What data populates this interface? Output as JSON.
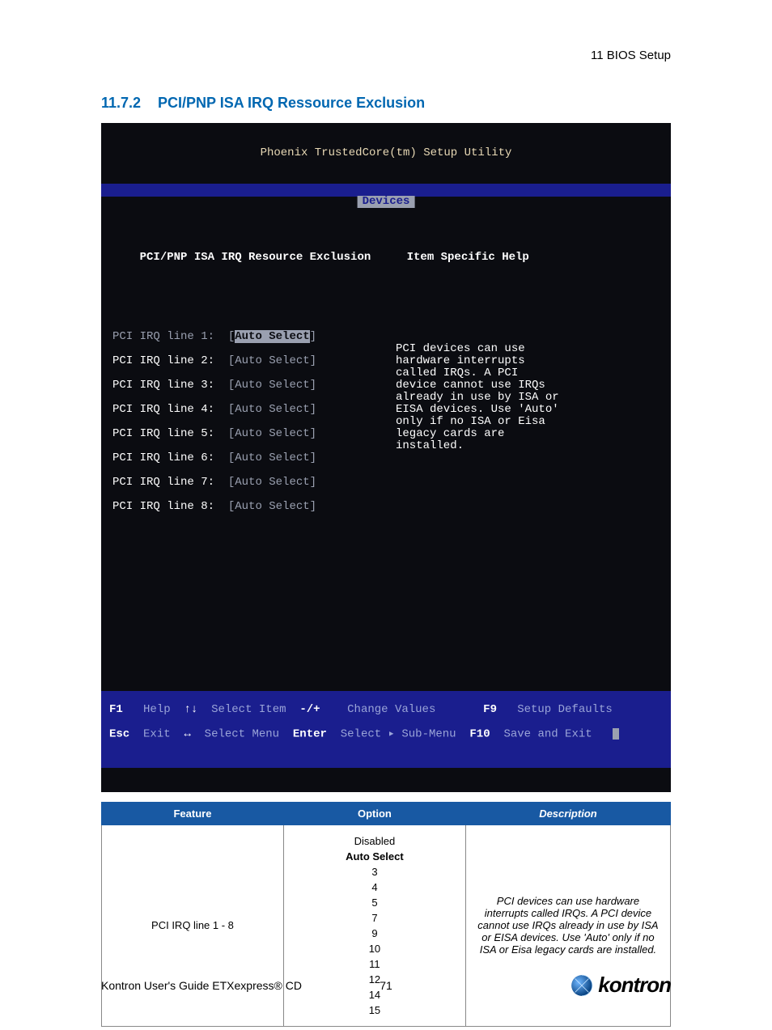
{
  "header": {
    "breadcrumb": "11 BIOS Setup"
  },
  "section": {
    "number": "11.7.2",
    "title": "PCI/PNP ISA IRQ Ressource Exclusion"
  },
  "bios": {
    "title": "Phoenix TrustedCore(tm) Setup Utility",
    "active_tab": "Devices",
    "panel_heading": "PCI/PNP ISA IRQ Resource Exclusion",
    "help_heading": "Item Specific Help",
    "lines": [
      {
        "label": "PCI IRQ line 1:",
        "value": "Auto Select",
        "selected": true
      },
      {
        "label": "PCI IRQ line 2:",
        "value": "Auto Select",
        "selected": false
      },
      {
        "label": "PCI IRQ line 3:",
        "value": "Auto Select",
        "selected": false
      },
      {
        "label": "PCI IRQ line 4:",
        "value": "Auto Select",
        "selected": false
      },
      {
        "label": "PCI IRQ line 5:",
        "value": "Auto Select",
        "selected": false
      },
      {
        "label": "PCI IRQ line 6:",
        "value": "Auto Select",
        "selected": false
      },
      {
        "label": "PCI IRQ line 7:",
        "value": "Auto Select",
        "selected": false
      },
      {
        "label": "PCI IRQ line 8:",
        "value": "Auto Select",
        "selected": false
      }
    ],
    "help_text": "PCI devices can use hardware interrupts called IRQs. A PCI device cannot use IRQs already in use by ISA or EISA devices. Use 'Auto' only if no ISA or Eisa legacy cards are installed.",
    "footer": {
      "f1": "F1",
      "help": "Help",
      "updown": "↑↓",
      "select_item": "Select Item",
      "pm": "-/+",
      "change_values": "Change Values",
      "f9": "F9",
      "setup_defaults": "Setup Defaults",
      "esc": "Esc",
      "exit": "Exit",
      "lr": "↔",
      "select_menu": "Select Menu",
      "enter": "Enter",
      "select_sub": "Select ▸ Sub-Menu",
      "f10": "F10",
      "save_exit": "Save and Exit"
    }
  },
  "table": {
    "col_feature": "Feature",
    "col_option": "Option",
    "col_desc": "Description",
    "feature": "PCI IRQ line 1 - 8",
    "options": [
      "Disabled",
      "Auto Select",
      "3",
      "4",
      "5",
      "7",
      "9",
      "10",
      "11",
      "12",
      "14",
      "15"
    ],
    "default_option_index": 1,
    "description": "PCI devices can use hardware interrupts called IRQs. A PCI device cannot use IRQs already in use by ISA or EISA devices. Use 'Auto' only if no ISA or Eisa legacy cards are installed."
  },
  "footer": {
    "left": "Kontron User's Guide ETXexpress® CD",
    "page": "71",
    "logo_text": "kontron"
  },
  "colors": {
    "brand_blue": "#0067b1",
    "table_header_blue": "#1859a3",
    "bios_bar_blue": "#1a1e8e",
    "bios_bg": "#0b0c11"
  }
}
